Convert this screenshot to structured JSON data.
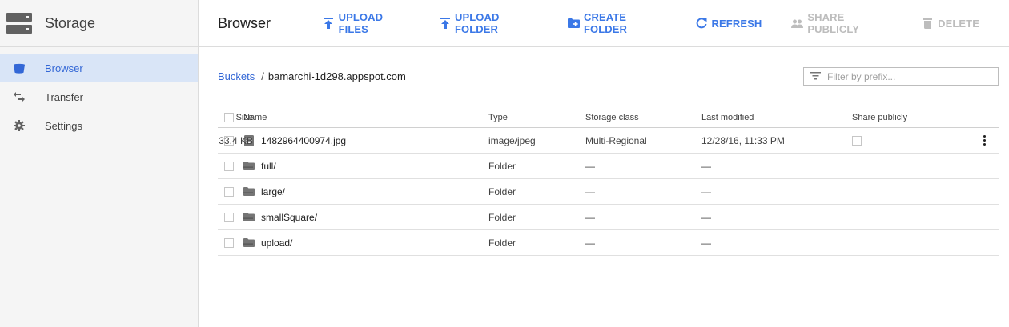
{
  "sidebar": {
    "title": "Storage",
    "items": [
      {
        "label": "Browser",
        "icon": "bucket-icon",
        "active": true
      },
      {
        "label": "Transfer",
        "icon": "transfer-arrows-icon",
        "active": false
      },
      {
        "label": "Settings",
        "icon": "gear-icon",
        "active": false
      }
    ]
  },
  "toolbar": {
    "title": "Browser",
    "upload_files": "UPLOAD FILES",
    "upload_folder": "UPLOAD FOLDER",
    "create_folder": "CREATE FOLDER",
    "refresh": "REFRESH",
    "share_publicly": "SHARE PUBLICLY",
    "delete": "DELETE"
  },
  "breadcrumb": {
    "root": "Buckets",
    "separator": "/",
    "current": "bamarchi-1d298.appspot.com"
  },
  "filter": {
    "placeholder": "Filter by prefix..."
  },
  "table": {
    "headers": {
      "name": "Name",
      "size": "Size",
      "type": "Type",
      "storage_class": "Storage class",
      "last_modified": "Last modified",
      "share_publicly": "Share publicly"
    },
    "rows": [
      {
        "name": "1482964400974.jpg",
        "size": "33.4 KB",
        "type": "image/jpeg",
        "storage_class": "Multi-Regional",
        "last_modified": "12/28/16, 11:33 PM",
        "kind": "file"
      },
      {
        "name": "full/",
        "size": "—",
        "type": "Folder",
        "storage_class": "—",
        "last_modified": "—",
        "kind": "folder"
      },
      {
        "name": "large/",
        "size": "—",
        "type": "Folder",
        "storage_class": "—",
        "last_modified": "—",
        "kind": "folder"
      },
      {
        "name": "smallSquare/",
        "size": "—",
        "type": "Folder",
        "storage_class": "—",
        "last_modified": "—",
        "kind": "folder"
      },
      {
        "name": "upload/",
        "size": "—",
        "type": "Folder",
        "storage_class": "—",
        "last_modified": "—",
        "kind": "folder"
      }
    ]
  },
  "colors": {
    "accent": "#3b78e7",
    "link": "#3367d6",
    "active_nav_bg": "#d9e5f7",
    "disabled": "#bdbdbd"
  }
}
